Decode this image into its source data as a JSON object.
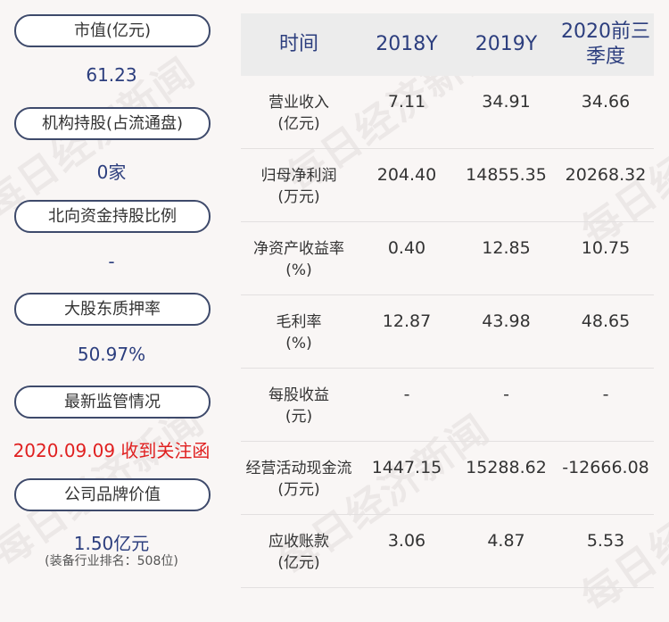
{
  "left": {
    "items": [
      {
        "label": "市值(亿元)",
        "value": "61.23"
      },
      {
        "label": "机构持股(占流通盘)",
        "value": "0家"
      },
      {
        "label": "北向资金持股比例",
        "value": "-"
      },
      {
        "label": "大股东质押率",
        "value": "50.97%"
      },
      {
        "label": "最新监管情况",
        "value": "2020.09.09 收到关注函"
      },
      {
        "label": "公司品牌价值",
        "value": "1.50亿元",
        "note": "(装备行业排名：508位)"
      }
    ]
  },
  "table": {
    "headers": [
      "时间",
      "2018Y",
      "2019Y",
      "2020前三季度"
    ],
    "rows": [
      {
        "label": "营业收入",
        "unit": "(亿元)",
        "values": [
          "7.11",
          "34.91",
          "34.66"
        ]
      },
      {
        "label": "归母净利润",
        "unit": "(万元)",
        "values": [
          "204.40",
          "14855.35",
          "20268.32"
        ]
      },
      {
        "label": "净资产收益率",
        "unit": "(%)",
        "values": [
          "0.40",
          "12.85",
          "10.75"
        ]
      },
      {
        "label": "毛利率",
        "unit": "(%)",
        "values": [
          "12.87",
          "43.98",
          "48.65"
        ]
      },
      {
        "label": "每股收益",
        "unit": "(元)",
        "values": [
          "-",
          "-",
          "-"
        ]
      },
      {
        "label": "经营活动现金流",
        "unit": "(万元)",
        "values": [
          "1447.15",
          "15288.62",
          "-12666.08"
        ]
      },
      {
        "label": "应收账款",
        "unit": "(亿元)",
        "values": [
          "3.06",
          "4.87",
          "5.53"
        ]
      }
    ]
  },
  "watermark": {
    "text": "每日经济新闻"
  },
  "colors": {
    "accent": "#2c3e7e",
    "alert": "#e02020",
    "border": "#3e4a6b"
  }
}
